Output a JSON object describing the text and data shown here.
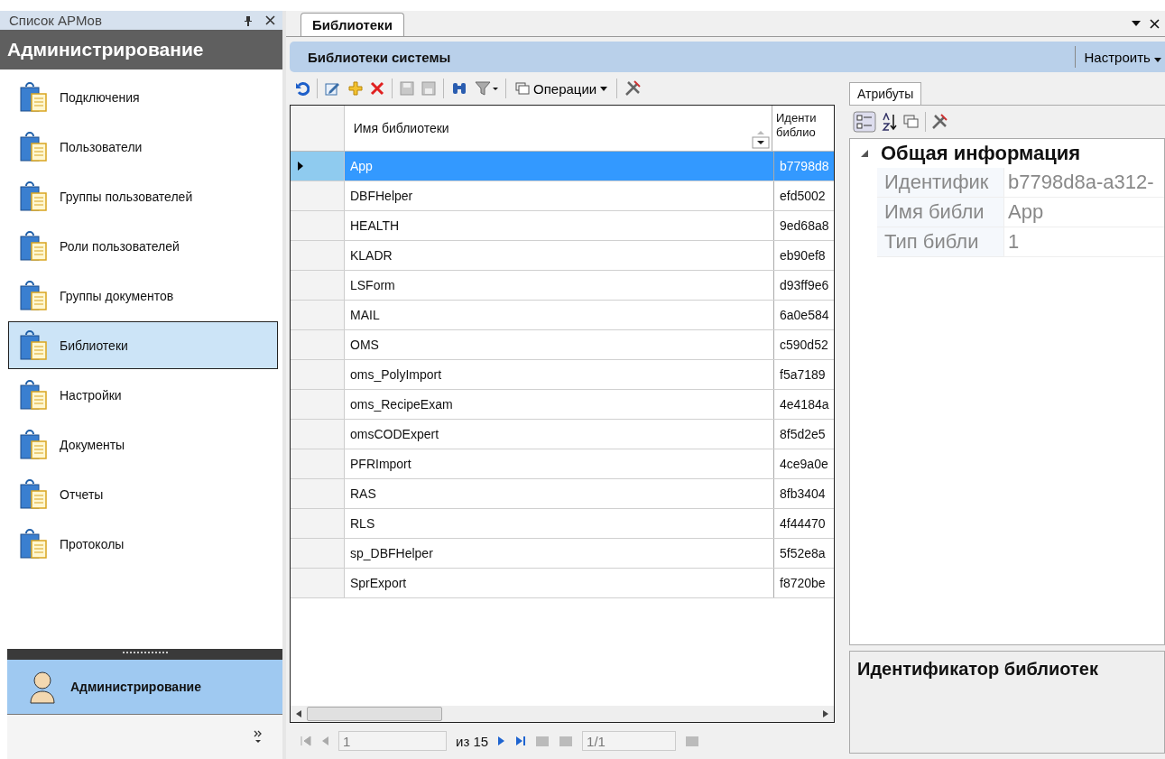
{
  "left_panel": {
    "title": "Список АРМов",
    "header": "Администрирование",
    "items": [
      {
        "label": "Подключения",
        "selected": false
      },
      {
        "label": "Пользователи",
        "selected": false
      },
      {
        "label": "Группы пользователей",
        "selected": false
      },
      {
        "label": "Роли пользователей",
        "selected": false
      },
      {
        "label": "Группы документов",
        "selected": false
      },
      {
        "label": "Библиотеки",
        "selected": true
      },
      {
        "label": "Настройки",
        "selected": false
      },
      {
        "label": "Документы",
        "selected": false
      },
      {
        "label": "Отчеты",
        "selected": false
      },
      {
        "label": "Протоколы",
        "selected": false
      }
    ],
    "workspace_button": {
      "label": "Администрирование",
      "selected": true
    }
  },
  "tabs": [
    {
      "label": "Библиотеки",
      "selected": true
    }
  ],
  "header": {
    "title": "Библиотеки системы",
    "customize": "Настроить"
  },
  "toolbar": {
    "operations": "Операции"
  },
  "table": {
    "columns": [
      "Имя библиотеки",
      "Иденти библио"
    ],
    "rows": [
      {
        "name": "App",
        "id": "b7798d8",
        "selected": true
      },
      {
        "name": "DBFHelper",
        "id": "efd5002",
        "selected": false
      },
      {
        "name": "HEALTH",
        "id": "9ed68a8",
        "selected": false
      },
      {
        "name": "KLADR",
        "id": "eb90ef8",
        "selected": false
      },
      {
        "name": "LSForm",
        "id": "d93ff9e6",
        "selected": false
      },
      {
        "name": "MAIL",
        "id": "6a0e584",
        "selected": false
      },
      {
        "name": "OMS",
        "id": "c590d52",
        "selected": false
      },
      {
        "name": "oms_PolyImport",
        "id": "f5a7189",
        "selected": false
      },
      {
        "name": "oms_RecipeExam",
        "id": "4e4184a",
        "selected": false
      },
      {
        "name": "omsCODExpert",
        "id": "8f5d2e5",
        "selected": false
      },
      {
        "name": "PFRImport",
        "id": "4ce9a0e",
        "selected": false
      },
      {
        "name": "RAS",
        "id": "8fb3404",
        "selected": false
      },
      {
        "name": "RLS",
        "id": "4f44470",
        "selected": false
      },
      {
        "name": "sp_DBFHelper",
        "id": "5f52e8a",
        "selected": false
      },
      {
        "name": "SprExport",
        "id": "f8720be",
        "selected": false
      }
    ]
  },
  "pager": {
    "page": "1",
    "of": "из 15",
    "records": "1/1"
  },
  "properties": {
    "tab": {
      "label": "Атрибуты",
      "selected": true
    },
    "category": "Общая информация",
    "rows": [
      {
        "name": "Идентифик",
        "value": "b7798d8a-a312-"
      },
      {
        "name": "Имя библи",
        "value": "App"
      },
      {
        "name": "Тип библи",
        "value": "1"
      }
    ],
    "description": "Идентификатор библиотек"
  }
}
